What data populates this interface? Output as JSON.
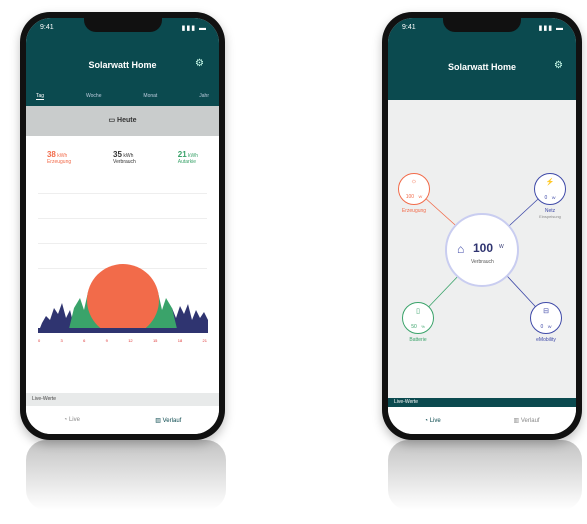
{
  "left_phone": {
    "status": {
      "time": "9:41",
      "indicators": "▮▮▮ ▬"
    },
    "title": "Solarwatt Home",
    "tabs": [
      "Tag",
      "Woche",
      "Monat",
      "Jahr"
    ],
    "date_label": "Heute",
    "stats": [
      {
        "value": "38",
        "unit": "kWh",
        "label": "Erzeugung",
        "color": "#f26b4a"
      },
      {
        "value": "35",
        "unit": "kWh",
        "label": "Verbrauch",
        "color": "#333333"
      },
      {
        "value": "21",
        "unit": "kWh",
        "label": "Autarkie",
        "color": "#3aa36a"
      }
    ],
    "time_ticks": [
      "0",
      "3",
      "6",
      "9",
      "12",
      "15",
      "18",
      "21"
    ],
    "section_title": "Live-Werte",
    "nav": [
      {
        "label": "Live",
        "icon": "gauge-icon"
      },
      {
        "label": "Verlauf",
        "icon": "bar-chart-icon"
      }
    ]
  },
  "right_phone": {
    "status": {
      "time": "9:41",
      "indicators": "▮▮▮ ▬"
    },
    "title": "Solarwatt Home",
    "center": {
      "value": "100",
      "unit": "W",
      "label": "Verbrauch"
    },
    "nodes": [
      {
        "id": "production",
        "value": "100",
        "unit": "W",
        "label": "Erzeugung",
        "color": "#f26b4a"
      },
      {
        "id": "grid",
        "value": "0",
        "unit": "W",
        "label": "Netz",
        "sublabel": "Einspeisung",
        "color": "#3f4aa8"
      },
      {
        "id": "battery",
        "value": "50",
        "unit": "%",
        "label": "Batterie",
        "color": "#3aa36a"
      },
      {
        "id": "wallbox",
        "value": "0",
        "unit": "W",
        "label": "eMobility",
        "color": "#3f4aa8"
      }
    ],
    "section_title": "Live-Werte",
    "nav": [
      {
        "label": "Live",
        "icon": "gauge-icon"
      },
      {
        "label": "Verlauf",
        "icon": "bar-chart-icon"
      }
    ]
  },
  "colors": {
    "header_bg": "#0b4a4f",
    "production": "#f26b4a",
    "battery": "#3aa36a",
    "grid": "#3f4aa8",
    "consumption_area": "#2f3470",
    "screen_bg_right": "#eeefef"
  }
}
